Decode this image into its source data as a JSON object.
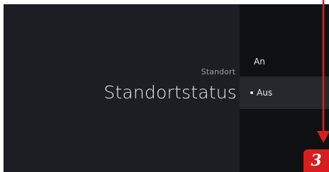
{
  "settings": {
    "category": "Standort",
    "title": "Standortstatus"
  },
  "options": [
    {
      "label": "An",
      "selected": false
    },
    {
      "label": "Aus",
      "selected": true
    }
  ],
  "annotation": {
    "step_number": "3",
    "color": "#d71e1e"
  },
  "theme": {
    "left_panel_bg": "#1b1e23",
    "right_panel_bg": "#0e1013",
    "selected_bg": "#25282d",
    "text_primary": "#e8eaed",
    "text_secondary": "#9aa0a6"
  }
}
